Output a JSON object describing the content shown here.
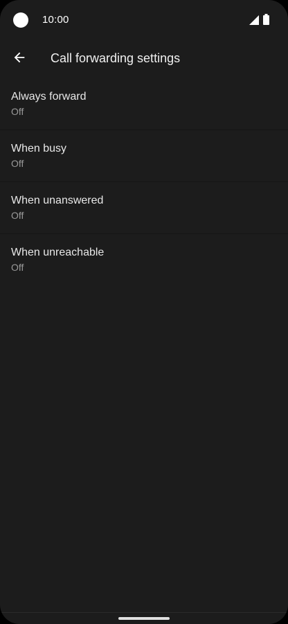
{
  "status_bar": {
    "time": "10:00",
    "icons": [
      "camera-cutout",
      "signal-icon",
      "battery-icon"
    ]
  },
  "app_bar": {
    "back_icon": "arrow-back-icon",
    "title": "Call forwarding settings"
  },
  "settings": [
    {
      "title": "Always forward",
      "summary": "Off"
    },
    {
      "title": "When busy",
      "summary": "Off"
    },
    {
      "title": "When unanswered",
      "summary": "Off"
    },
    {
      "title": "When unreachable",
      "summary": "Off"
    }
  ],
  "colors": {
    "background": "#1c1c1c",
    "title_text": "#e8e8e8",
    "summary_text": "#9a9a9a"
  }
}
